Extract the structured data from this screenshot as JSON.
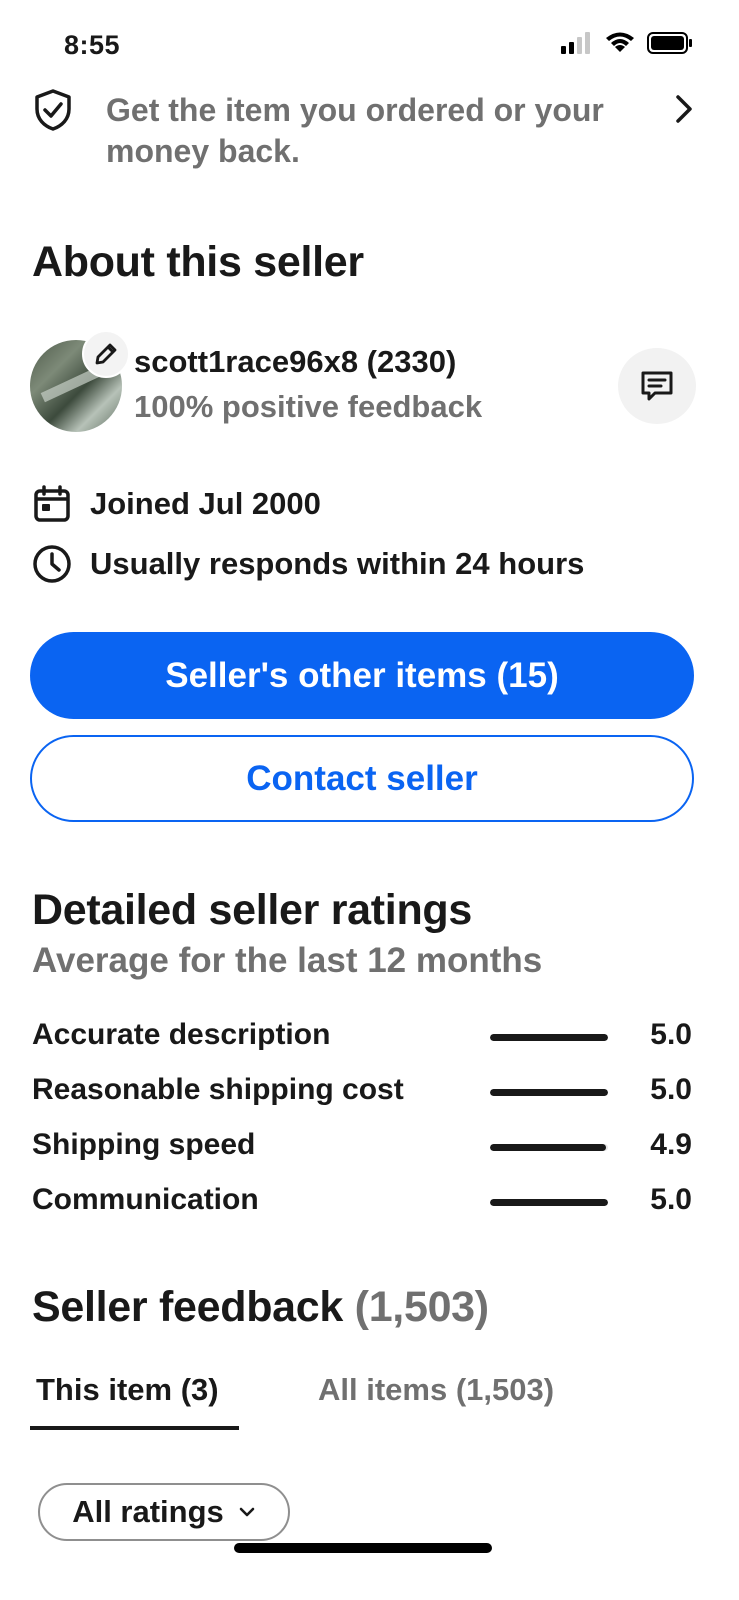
{
  "status_bar": {
    "time": "8:55"
  },
  "guarantee": {
    "text": "Get the item you ordered or your money back.",
    "icon": "shield-check-icon"
  },
  "about": {
    "title": "About this seller",
    "seller_name": "scott1race96x8 (2330)",
    "positive_feedback": "100% positive feedback",
    "joined": "Joined Jul 2000",
    "response_time": "Usually responds within 24 hours",
    "other_items_button": "Seller's other items (15)",
    "contact_button": "Contact seller"
  },
  "ratings": {
    "title": "Detailed seller ratings",
    "subtitle": "Average for the last 12 months",
    "items": [
      {
        "label": "Accurate description",
        "value": "5.0",
        "fill_fraction": 1.0
      },
      {
        "label": "Reasonable shipping cost",
        "value": "5.0",
        "fill_fraction": 1.0
      },
      {
        "label": "Shipping speed",
        "value": "4.9",
        "fill_fraction": 0.98
      },
      {
        "label": "Communication",
        "value": "5.0",
        "fill_fraction": 1.0
      }
    ]
  },
  "feedback": {
    "title": "Seller feedback",
    "count": "(1,503)",
    "tabs": [
      {
        "label": "This item (3)",
        "active": true
      },
      {
        "label": "All items (1,503)",
        "active": false
      }
    ],
    "filter_label": "All ratings"
  },
  "colors": {
    "accent": "#0a64f2",
    "text": "#191919",
    "muted": "#707070"
  }
}
